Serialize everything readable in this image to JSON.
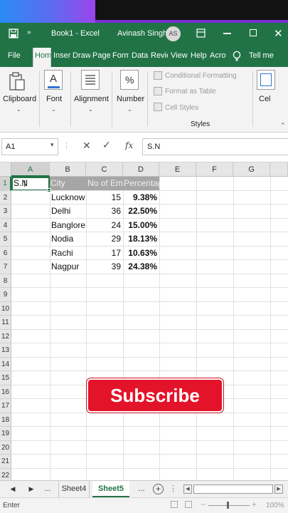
{
  "title_bar": {
    "file_name": "Book1 - Excel",
    "user_name": "Avinash Singh",
    "avatar_initials": "AS"
  },
  "ribbon_tabs": [
    "File",
    "Hom",
    "Inser",
    "Draw",
    "Page",
    "Form",
    "Data",
    "Revie",
    "View",
    "Help",
    "Acro",
    "Tell me"
  ],
  "ribbon": {
    "clipboard_label": "Clipboard",
    "font_label": "Font",
    "alignment_label": "Alignment",
    "number_label": "Number",
    "number_icon": "%",
    "conditional_formatting": "Conditional Formatting",
    "format_as_table": "Format as Table",
    "cell_styles": "Cell Styles",
    "styles_group": "Styles",
    "cells_label": "Cel"
  },
  "formula_bar": {
    "name_box": "A1",
    "fx_label": "fx",
    "content": "S.N"
  },
  "columns": [
    "A",
    "B",
    "C",
    "D",
    "E",
    "F",
    "G"
  ],
  "rows": [
    "1",
    "2",
    "3",
    "4",
    "5",
    "6",
    "7",
    "8",
    "9",
    "10",
    "11",
    "12",
    "13",
    "14",
    "15",
    "16",
    "17",
    "18",
    "19",
    "20",
    "21",
    "22"
  ],
  "table": {
    "headers": [
      "S.N",
      "City",
      "No of Emp",
      "Percentage"
    ],
    "rows": [
      {
        "city": "Lucknow",
        "emp": "15",
        "pct": "9.38%"
      },
      {
        "city": "Delhi",
        "emp": "36",
        "pct": "22.50%"
      },
      {
        "city": "Banglore",
        "emp": "24",
        "pct": "15.00%"
      },
      {
        "city": "Nodia",
        "emp": "29",
        "pct": "18.13%"
      },
      {
        "city": "Rachi",
        "emp": "17",
        "pct": "10.63%"
      },
      {
        "city": "Nagpur",
        "emp": "39",
        "pct": "24.38%"
      }
    ]
  },
  "overlay": {
    "subscribe": "Subscribe"
  },
  "sheet_tabs": {
    "ellipsis": "...",
    "tabs": [
      "Sheet4",
      "Sheet5"
    ],
    "active": "Sheet5"
  },
  "status_bar": {
    "mode": "Enter",
    "zoom": "100%"
  },
  "colors": {
    "excel_green": "#217346",
    "subscribe_red": "#e3132a"
  }
}
